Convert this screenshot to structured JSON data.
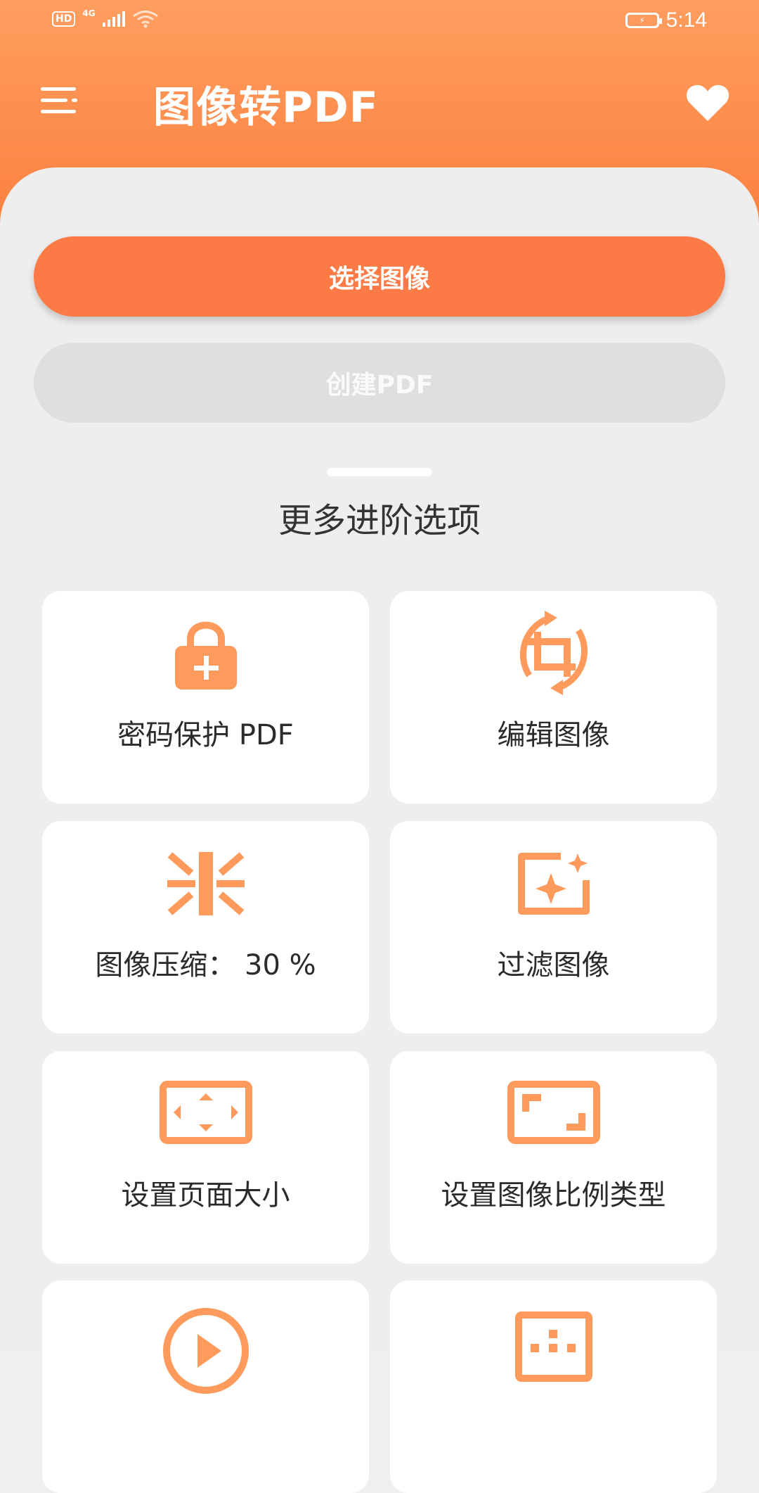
{
  "status_bar": {
    "hd": "HD",
    "network": "4G",
    "time": "5:14"
  },
  "app_bar": {
    "title": "图像转PDF",
    "menu_icon": "menu-icon",
    "favorite_icon": "heart-icon"
  },
  "actions": {
    "select_images": "选择图像",
    "create_pdf": "创建PDF"
  },
  "section": {
    "title": "更多进阶选项"
  },
  "options": [
    {
      "label": "密码保护 PDF",
      "icon": "lock-add-icon"
    },
    {
      "label": "编辑图像",
      "icon": "crop-rotate-icon"
    },
    {
      "label": "图像压缩：  30 %",
      "icon": "compress-icon"
    },
    {
      "label": "过滤图像",
      "icon": "filter-sparkle-icon"
    },
    {
      "label": "设置页面大小",
      "icon": "page-size-icon"
    },
    {
      "label": "设置图像比例类型",
      "icon": "aspect-ratio-icon"
    },
    {
      "label": "",
      "icon": "play-icon"
    },
    {
      "label": "",
      "icon": "grid-icon"
    }
  ],
  "colors": {
    "accent": "#fb7a45",
    "icon": "#fd9a5c",
    "header_top": "#ff9e5f",
    "header_bottom": "#fb8140"
  }
}
